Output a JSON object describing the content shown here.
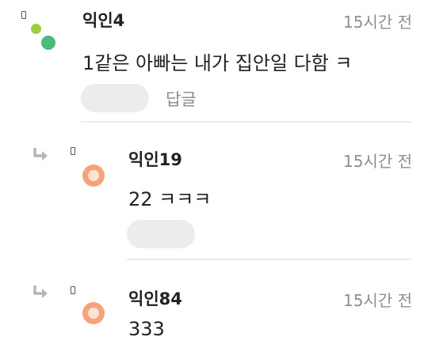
{
  "comments": [
    {
      "author": "익인4",
      "time": "15시간 전",
      "text": "1같은 아빠는 내가 집안일 다함 ㅋ",
      "reply_label": "답글",
      "is_reply": false
    },
    {
      "author": "익인19",
      "time": "15시간 전",
      "text": "22 ㅋㅋㅋ",
      "is_reply": true
    },
    {
      "author": "익인84",
      "time": "15시간 전",
      "text": "333",
      "is_reply": true
    }
  ],
  "icons": {
    "flag": "flag-icon",
    "reply_arrow": "reply-arrow-icon",
    "avatar_top": "green-dots-avatar",
    "avatar_reply": "orange-ring-avatar"
  },
  "colors": {
    "avatar_green_small": "#9ccf3a",
    "avatar_green_big": "#4cbb7c",
    "avatar_orange": "#f7a27a",
    "avatar_orange_inner": "#fde3d6",
    "time_text": "#8e8e8e",
    "pill_bg": "#ececec",
    "divider": "#ebebeb"
  }
}
